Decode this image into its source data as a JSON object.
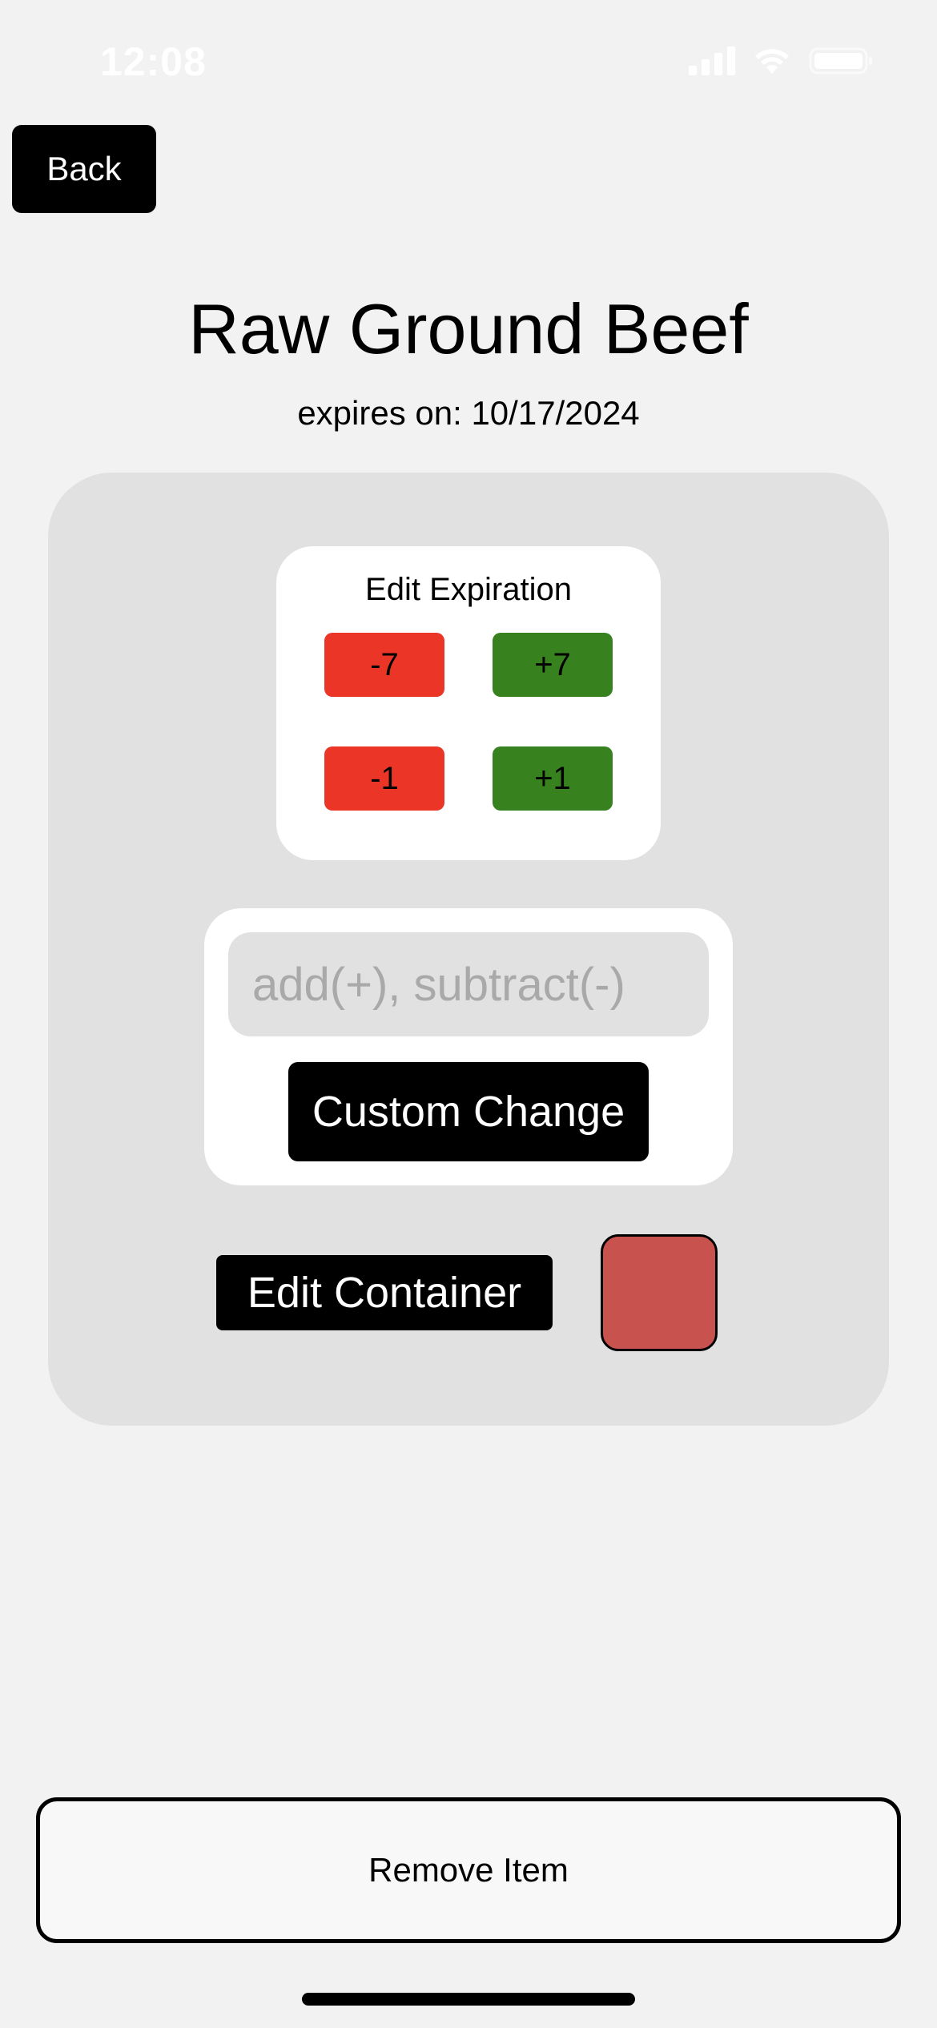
{
  "status_bar": {
    "time": "12:08",
    "signal_icon": "cellular-signal-icon",
    "wifi_icon": "wifi-icon",
    "battery_icon": "battery-icon"
  },
  "nav": {
    "back_label": "Back"
  },
  "item": {
    "name": "Raw Ground Beef",
    "expires_prefix": "expires on:",
    "expires_date": "10/17/2024"
  },
  "edit_expiration": {
    "title": "Edit Expiration",
    "buttons": [
      {
        "label": "-7",
        "color": "#eb3527"
      },
      {
        "label": "+7",
        "color": "#37811e"
      },
      {
        "label": "-1",
        "color": "#eb3527"
      },
      {
        "label": "+1",
        "color": "#37811e"
      }
    ]
  },
  "custom_change": {
    "input_value": "",
    "placeholder": "add(+), subtract(-)",
    "button_label": "Custom Change"
  },
  "container": {
    "button_label": "Edit Container",
    "color": "#c8524d"
  },
  "actions": {
    "remove_label": "Remove Item"
  },
  "colors": {
    "background": "#f2f2f2",
    "panel": "#e1e1e1",
    "primary_button": "#000000"
  }
}
